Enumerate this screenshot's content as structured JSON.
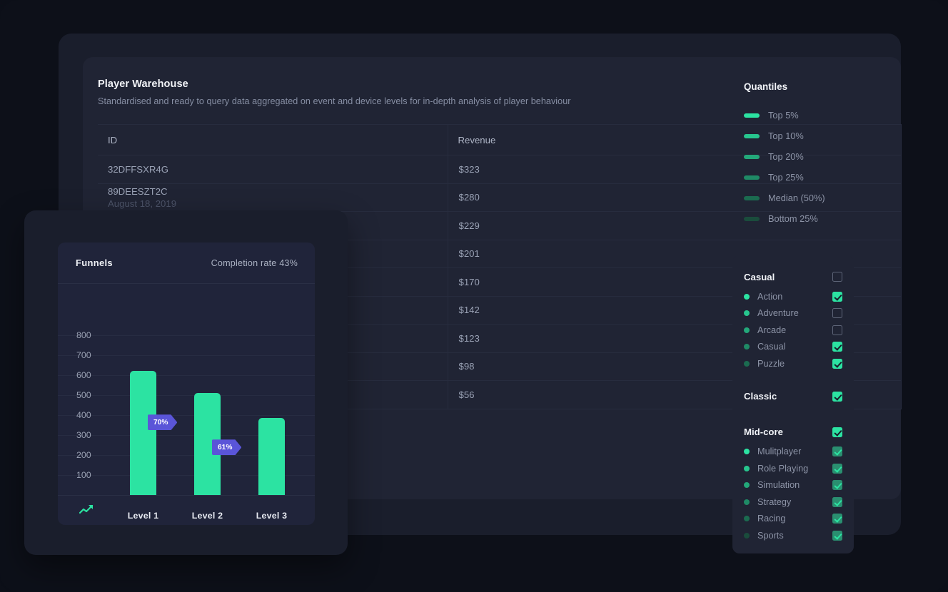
{
  "warehouse": {
    "title": "Player Warehouse",
    "subtitle": "Standardised and ready to query data aggregated on event and device levels for in-depth analysis of player behaviour",
    "columns": [
      "ID",
      "Revenue"
    ],
    "rows": [
      {
        "id": "32DFFSXR4G",
        "date": "",
        "revenue": "$323"
      },
      {
        "id": "89DEESZT2C",
        "date": "August 18, 2019",
        "revenue": "$280"
      },
      {
        "id": "",
        "date": "",
        "revenue": "$229"
      },
      {
        "id": "",
        "date": "",
        "revenue": "$201"
      },
      {
        "id": "",
        "date": "",
        "revenue": "$170"
      },
      {
        "id": "",
        "date": "",
        "revenue": "$142"
      },
      {
        "id": "",
        "date": "",
        "revenue": "$123"
      },
      {
        "id": "",
        "date": "",
        "revenue": "$98"
      },
      {
        "id": "",
        "date": "",
        "revenue": "$56"
      }
    ]
  },
  "quantiles": {
    "title": "Quantiles",
    "items": [
      {
        "label": "Top 5%",
        "color": "#2ce3a2"
      },
      {
        "label": "Top 10%",
        "color": "#27c68e"
      },
      {
        "label": "Top 20%",
        "color": "#23a87a"
      },
      {
        "label": "Top 25%",
        "color": "#1f8a66"
      },
      {
        "label": "Median (50%)",
        "color": "#1b6b50"
      },
      {
        "label": "Bottom 25%",
        "color": "#1a4c3c"
      }
    ]
  },
  "categories": {
    "groups": [
      {
        "name": "Casual",
        "checked": false,
        "items": [
          {
            "label": "Action",
            "dot": "#2ce3a2",
            "checked": true,
            "dim": false
          },
          {
            "label": "Adventure",
            "dot": "#27c68e",
            "checked": false,
            "dim": false
          },
          {
            "label": "Arcade",
            "dot": "#23a87a",
            "checked": false,
            "dim": false
          },
          {
            "label": "Casual",
            "dot": "#1f8a66",
            "checked": true,
            "dim": false
          },
          {
            "label": "Puzzle",
            "dot": "#1b6b50",
            "checked": true,
            "dim": false
          }
        ]
      },
      {
        "name": "Classic",
        "checked": true,
        "items": []
      },
      {
        "name": "Mid-core",
        "checked": true,
        "items": [
          {
            "label": "Mulitplayer",
            "dot": "#2ce3a2",
            "checked": true,
            "dim": true
          },
          {
            "label": "Role Playing",
            "dot": "#27c68e",
            "checked": true,
            "dim": true
          },
          {
            "label": "Simulation",
            "dot": "#23a87a",
            "checked": true,
            "dim": true
          },
          {
            "label": "Strategy",
            "dot": "#1f8a66",
            "checked": true,
            "dim": true
          },
          {
            "label": "Racing",
            "dot": "#1b6b50",
            "checked": true,
            "dim": true
          },
          {
            "label": "Sports",
            "dot": "#1a4c3c",
            "checked": true,
            "dim": true
          }
        ]
      }
    ]
  },
  "funnels": {
    "title": "Funnels",
    "completion_label": "Completion rate 43%",
    "trend_icon": "trending-up-icon"
  },
  "chart_data": {
    "type": "bar",
    "title": "Funnels",
    "categories": [
      "Level 1",
      "Level 2",
      "Level 3"
    ],
    "values": [
      620,
      510,
      385
    ],
    "xlabel": "",
    "ylabel": "",
    "ylim": [
      0,
      850
    ],
    "yticks": [
      100,
      200,
      300,
      400,
      500,
      600,
      700,
      800
    ],
    "grid": true,
    "bar_color": "#2ce3a2",
    "annotations": [
      {
        "label": "70%",
        "from": "Level 1",
        "to": "Level 2",
        "color": "#5a55d8"
      },
      {
        "label": "61%",
        "from": "Level 2",
        "to": "Level 3",
        "color": "#5a55d8"
      }
    ],
    "legend": "none"
  }
}
